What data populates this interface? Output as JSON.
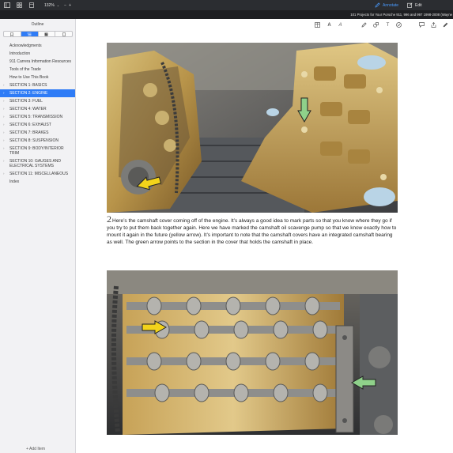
{
  "toolbar": {
    "zoom_label": "132%",
    "annotate_label": "Annotate",
    "edit_label": "Edit"
  },
  "window": {
    "title": "101 Projects for Your Porsche 911, 996 and 997 1998-2008 (Wayne"
  },
  "sidebar": {
    "title": "Outline",
    "tabs": [
      "bookmark-icon",
      "outline-icon",
      "image-icon",
      "page-icon"
    ],
    "items": [
      {
        "label": "Acknowledgments",
        "expandable": false,
        "selected": false
      },
      {
        "label": "Introduction",
        "expandable": false,
        "selected": false
      },
      {
        "label": "911 Carrera Information Resources",
        "expandable": false,
        "selected": false
      },
      {
        "label": "Tools of the Trade",
        "expandable": false,
        "selected": false
      },
      {
        "label": "How to Use This Book",
        "expandable": false,
        "selected": false
      },
      {
        "label": "SECTION 1: BASICS",
        "expandable": true,
        "selected": false
      },
      {
        "label": "SECTION 2: ENGINE",
        "expandable": true,
        "selected": true
      },
      {
        "label": "SECTION 3: FUEL",
        "expandable": true,
        "selected": false
      },
      {
        "label": "SECTION 4: WATER",
        "expandable": true,
        "selected": false
      },
      {
        "label": "SECTION 5: TRANSMISSION",
        "expandable": true,
        "selected": false
      },
      {
        "label": "SECTION 6: EXHAUST",
        "expandable": true,
        "selected": false
      },
      {
        "label": "SECTION 7: BRAKES",
        "expandable": true,
        "selected": false
      },
      {
        "label": "SECTION 8: SUSPENSION",
        "expandable": true,
        "selected": false
      },
      {
        "label": "SECTION 9: BODY/INTERIOR TRIM",
        "expandable": true,
        "selected": false
      },
      {
        "label": "SECTION 10: GAUGES AND ELECTRICAL SYSTEMS",
        "expandable": true,
        "selected": false
      },
      {
        "label": "SECTION 11: MISCELLANEOUS",
        "expandable": true,
        "selected": false
      },
      {
        "label": "Index",
        "expandable": false,
        "selected": false
      }
    ],
    "add_item_label": "Add Item"
  },
  "page": {
    "caption_number": "2",
    "caption_text": "Here’s the camshaft cover coming off of the engine. It’s always a good idea to mark parts so that you know where they go if you try to put them back together again. Here we have marked the camshaft oil scavenge pump so that we know exactly how to mount it again in the future (yellow arrow). It’s important to note that the camshaft covers have an integrated camshaft bearing as well. The green arrow points to the section in the cover that holds the camshaft in place."
  },
  "colors": {
    "accent": "#2f7cf6",
    "toolbar_bg": "#2b2d31",
    "titlebar_bg": "#1e1f22",
    "sidebar_bg": "#f2f2f4",
    "annotate": "#4a9bff"
  }
}
